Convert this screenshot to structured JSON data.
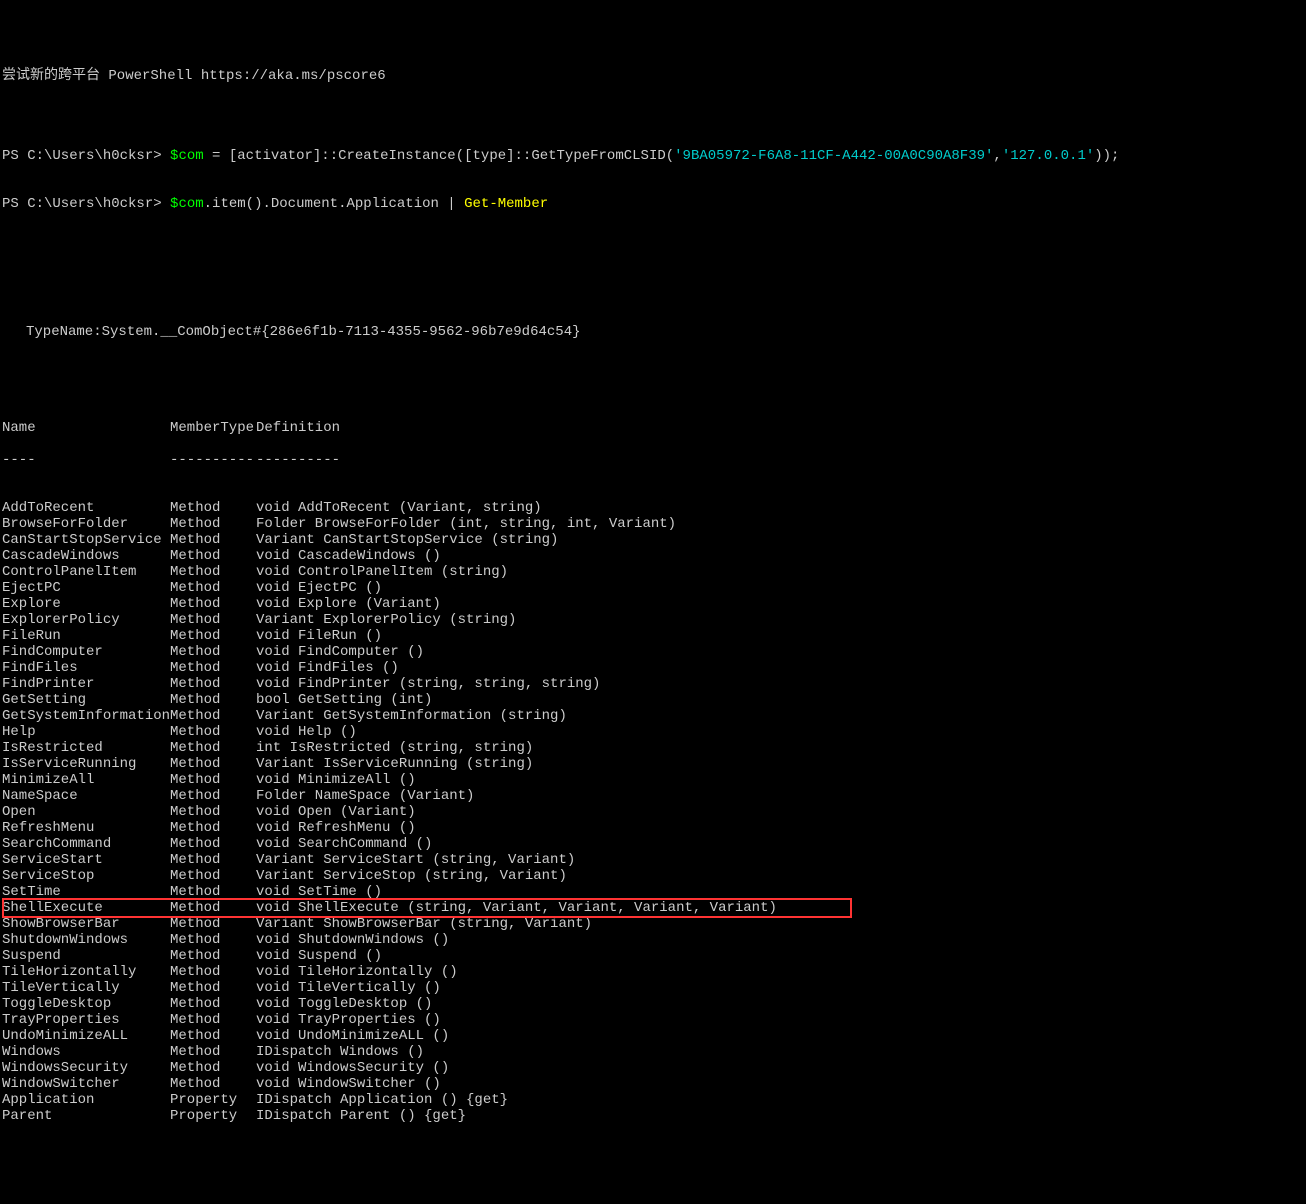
{
  "headerLine": "尝试新的跨平台 PowerShell https://aka.ms/pscore6",
  "promptPath": "PS C:\\Users\\h0cksr>",
  "cmd1": {
    "var": "$com",
    "eq": " = ",
    "prefix": "[activator]::CreateInstance([type]::GetTypeFromCLSID(",
    "arg1": "'9BA05972-F6A8-11CF-A442-00A0C90A8F39'",
    "comma": ",",
    "arg2": "'127.0.0.1'",
    "suffix": "));"
  },
  "cmd2": {
    "var": "$com",
    "chain": ".item().Document.Application | ",
    "cmdlet": "Get-Member"
  },
  "typeLine": "TypeName:System.__ComObject#{286e6f1b-7113-4355-9562-96b7e9d64c54}",
  "headers": {
    "name": "Name",
    "type": "MemberType",
    "def": "Definition"
  },
  "dashes": {
    "name": "----",
    "type": "----------",
    "def": "----------"
  },
  "highlightName": "ShellExecute",
  "members": [
    {
      "n": "AddToRecent",
      "t": "Method",
      "d": "void AddToRecent (Variant, string)"
    },
    {
      "n": "BrowseForFolder",
      "t": "Method",
      "d": "Folder BrowseForFolder (int, string, int, Variant)"
    },
    {
      "n": "CanStartStopService",
      "t": "Method",
      "d": "Variant CanStartStopService (string)"
    },
    {
      "n": "CascadeWindows",
      "t": "Method",
      "d": "void CascadeWindows ()"
    },
    {
      "n": "ControlPanelItem",
      "t": "Method",
      "d": "void ControlPanelItem (string)"
    },
    {
      "n": "EjectPC",
      "t": "Method",
      "d": "void EjectPC ()"
    },
    {
      "n": "Explore",
      "t": "Method",
      "d": "void Explore (Variant)"
    },
    {
      "n": "ExplorerPolicy",
      "t": "Method",
      "d": "Variant ExplorerPolicy (string)"
    },
    {
      "n": "FileRun",
      "t": "Method",
      "d": "void FileRun ()"
    },
    {
      "n": "FindComputer",
      "t": "Method",
      "d": "void FindComputer ()"
    },
    {
      "n": "FindFiles",
      "t": "Method",
      "d": "void FindFiles ()"
    },
    {
      "n": "FindPrinter",
      "t": "Method",
      "d": "void FindPrinter (string, string, string)"
    },
    {
      "n": "GetSetting",
      "t": "Method",
      "d": "bool GetSetting (int)"
    },
    {
      "n": "GetSystemInformation",
      "t": "Method",
      "d": "Variant GetSystemInformation (string)"
    },
    {
      "n": "Help",
      "t": "Method",
      "d": "void Help ()"
    },
    {
      "n": "IsRestricted",
      "t": "Method",
      "d": "int IsRestricted (string, string)"
    },
    {
      "n": "IsServiceRunning",
      "t": "Method",
      "d": "Variant IsServiceRunning (string)"
    },
    {
      "n": "MinimizeAll",
      "t": "Method",
      "d": "void MinimizeAll ()"
    },
    {
      "n": "NameSpace",
      "t": "Method",
      "d": "Folder NameSpace (Variant)"
    },
    {
      "n": "Open",
      "t": "Method",
      "d": "void Open (Variant)"
    },
    {
      "n": "RefreshMenu",
      "t": "Method",
      "d": "void RefreshMenu ()"
    },
    {
      "n": "SearchCommand",
      "t": "Method",
      "d": "void SearchCommand ()"
    },
    {
      "n": "ServiceStart",
      "t": "Method",
      "d": "Variant ServiceStart (string, Variant)"
    },
    {
      "n": "ServiceStop",
      "t": "Method",
      "d": "Variant ServiceStop (string, Variant)"
    },
    {
      "n": "SetTime",
      "t": "Method",
      "d": "void SetTime ()"
    },
    {
      "n": "ShellExecute",
      "t": "Method",
      "d": "void ShellExecute (string, Variant, Variant, Variant, Variant)"
    },
    {
      "n": "ShowBrowserBar",
      "t": "Method",
      "d": "Variant ShowBrowserBar (string, Variant)"
    },
    {
      "n": "ShutdownWindows",
      "t": "Method",
      "d": "void ShutdownWindows ()"
    },
    {
      "n": "Suspend",
      "t": "Method",
      "d": "void Suspend ()"
    },
    {
      "n": "TileHorizontally",
      "t": "Method",
      "d": "void TileHorizontally ()"
    },
    {
      "n": "TileVertically",
      "t": "Method",
      "d": "void TileVertically ()"
    },
    {
      "n": "ToggleDesktop",
      "t": "Method",
      "d": "void ToggleDesktop ()"
    },
    {
      "n": "TrayProperties",
      "t": "Method",
      "d": "void TrayProperties ()"
    },
    {
      "n": "UndoMinimizeALL",
      "t": "Method",
      "d": "void UndoMinimizeALL ()"
    },
    {
      "n": "Windows",
      "t": "Method",
      "d": "IDispatch Windows ()"
    },
    {
      "n": "WindowsSecurity",
      "t": "Method",
      "d": "void WindowsSecurity ()"
    },
    {
      "n": "WindowSwitcher",
      "t": "Method",
      "d": "void WindowSwitcher ()"
    },
    {
      "n": "Application",
      "t": "Property",
      "d": "IDispatch Application () {get}"
    },
    {
      "n": "Parent",
      "t": "Property",
      "d": "IDispatch Parent () {get}"
    }
  ]
}
